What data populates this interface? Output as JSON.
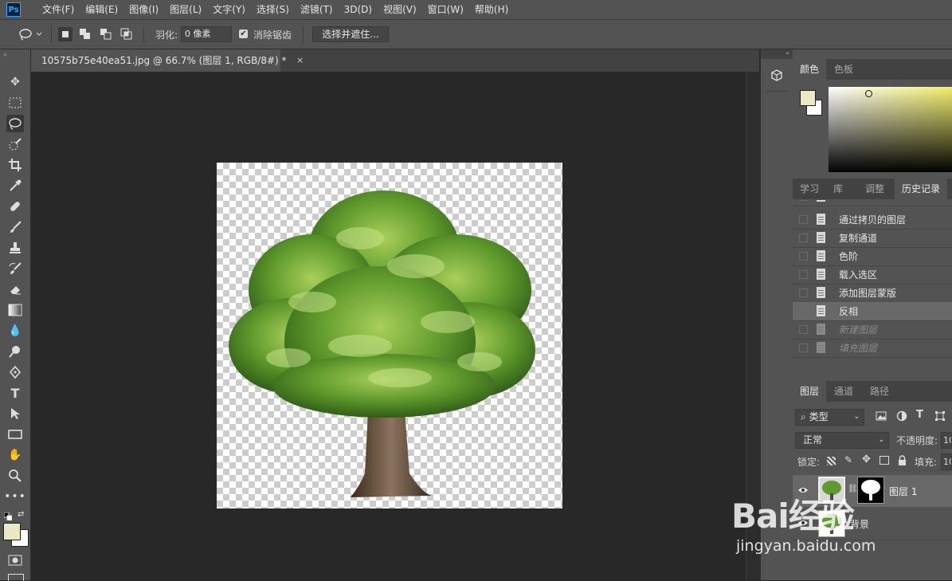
{
  "app": {
    "logo": "Ps"
  },
  "menu": [
    "文件(F)",
    "编辑(E)",
    "图像(I)",
    "图层(L)",
    "文字(Y)",
    "选择(S)",
    "滤镜(T)",
    "3D(D)",
    "视图(V)",
    "窗口(W)",
    "帮助(H)"
  ],
  "options": {
    "feather_label": "羽化:",
    "feather_value": "0 像素",
    "antialias_label": "消除锯齿",
    "antialias_checked": true,
    "select_and_mask": "选择并遮住..."
  },
  "document": {
    "tab_title": "10575b75e40ea51.jpg @ 66.7% (图层 1, RGB/8#) *",
    "close": "×"
  },
  "color_panel": {
    "tabs": [
      "颜色",
      "色板"
    ],
    "foreground": "#ece8c6",
    "background": "#ffffff",
    "hue_color": "#f2ef6b"
  },
  "history_panel": {
    "tabs": [
      "学习",
      "库",
      "调整",
      "历史记录"
    ],
    "partial_top": "...",
    "items": [
      {
        "label": "通过拷贝的图层",
        "state": "normal"
      },
      {
        "label": "复制通道",
        "state": "normal"
      },
      {
        "label": "色阶",
        "state": "normal"
      },
      {
        "label": "载入选区",
        "state": "normal"
      },
      {
        "label": "添加图层蒙版",
        "state": "normal"
      },
      {
        "label": "反相",
        "state": "current"
      },
      {
        "label": "新建图层",
        "state": "dim"
      },
      {
        "label": "填充图层",
        "state": "dim"
      }
    ]
  },
  "layers_panel": {
    "tabs": [
      "图层",
      "通道",
      "路径"
    ],
    "filter_kind": "类型",
    "blend_mode": "正常",
    "opacity_label": "不透明度:",
    "opacity_value": "10",
    "lock_label": "锁定:",
    "fill_label": "填充:",
    "fill_value": "10",
    "layers": [
      {
        "name": "图层 1",
        "selected": true
      },
      {
        "name": "背景",
        "selected": false
      }
    ]
  },
  "watermark": {
    "text": "Bai经验",
    "url": "jingyan.baidu.com"
  }
}
